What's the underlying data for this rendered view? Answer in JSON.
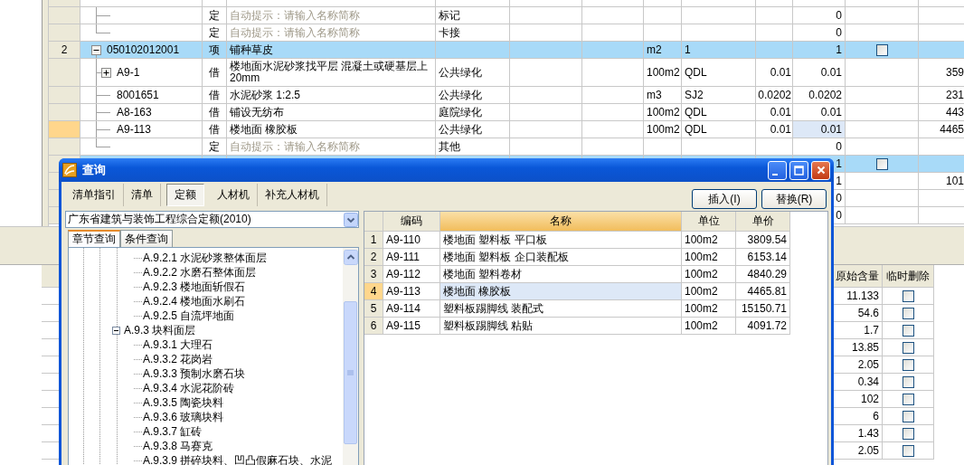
{
  "main_table": {
    "rows": [
      {
        "kind": "sub",
        "column_2": "定",
        "placeholder": "自动提示：请输入名称简称",
        "column_4": "标记",
        "column_10": "0",
        "selected": false,
        "current": false
      },
      {
        "kind": "sub",
        "column_2": "定",
        "placeholder": "自动提示：请输入名称简称",
        "column_4": "卡接",
        "column_10": "0",
        "selected": false,
        "current": false
      },
      {
        "kind": "item",
        "row_number": "2",
        "column_1": "050102012001",
        "expanded": true,
        "column_2": "项",
        "column_3": "铺种草皮",
        "column_7": "m2",
        "column_8": "1",
        "column_10": "1",
        "checked": false,
        "selected": true,
        "current": false,
        "children": [
          {
            "column_1": "A9-1",
            "expanded": false,
            "column_2": "借",
            "column_3": "楼地面水泥砂浆找平层 混凝土或硬基层上 20mm",
            "column_4": "公共绿化",
            "column_7": "100m2",
            "column_8": "QDL",
            "column_9": "0.01",
            "column_10": "0.01",
            "column_12": "359",
            "selected": false,
            "current": false
          },
          {
            "column_1": "8001651",
            "column_2": "借",
            "column_3": "水泥砂浆 1:2.5",
            "column_4": "公共绿化",
            "column_7": "m3",
            "column_8": "SJ2",
            "column_9": "0.0202",
            "column_10": "0.0202",
            "column_12": "231",
            "selected": false,
            "current": false
          },
          {
            "column_1": "A8-163",
            "column_2": "借",
            "column_3": "铺设无纺布",
            "column_4": "庭院绿化",
            "column_7": "100m2",
            "column_8": "QDL",
            "column_9": "0.01",
            "column_10": "0.01",
            "column_12": "443",
            "selected": false,
            "current": false
          },
          {
            "column_1": "A9-113",
            "column_2": "借",
            "column_3": "楼地面 橡胶板",
            "column_4": "公共绿化",
            "column_7": "100m2",
            "column_8": "QDL",
            "column_9": "0.01",
            "column_10": "0.01",
            "column_12": "4465",
            "selected": false,
            "current": true
          },
          {
            "column_2": "定",
            "placeholder": "自动提示：请输入名称简称",
            "column_4": "其他",
            "column_10": "0",
            "selected": false,
            "current": false
          }
        ]
      },
      {
        "kind": "item",
        "column_10": "1",
        "checked": false,
        "selected": true,
        "current": false,
        "children": [
          {
            "column_10": "1",
            "column_12": "101",
            "selected": false,
            "current": false
          },
          {
            "column_10": "0",
            "selected": false,
            "current": false
          },
          {
            "column_10": "0",
            "selected": false,
            "current": false
          }
        ]
      }
    ]
  },
  "lower_table": {
    "columns": [
      {
        "label": "原始含量"
      },
      {
        "label": "临时删除"
      }
    ],
    "rows": [
      {
        "value": "11.133",
        "checked": false
      },
      {
        "value": "54.6",
        "checked": false
      },
      {
        "value": "1.7",
        "checked": false
      },
      {
        "value": "13.85",
        "checked": false
      },
      {
        "value": "2.05",
        "checked": false
      },
      {
        "value": "0.34",
        "checked": false
      },
      {
        "value": "102",
        "checked": false
      },
      {
        "value": "6",
        "checked": false
      },
      {
        "value": "1.43",
        "checked": false
      },
      {
        "value": "2.05",
        "checked": false
      }
    ]
  },
  "dialog": {
    "title": "查询",
    "tabs": [
      {
        "label": "清单指引",
        "selected": false
      },
      {
        "label": "清单",
        "selected": false
      },
      {
        "label": "定额",
        "selected": true
      },
      {
        "label": "人材机",
        "selected": false
      },
      {
        "label": "补充人材机",
        "selected": false
      }
    ],
    "buttons": [
      "插入(I)",
      "替换(R)"
    ],
    "library": {
      "value": "广东省建筑与装饰工程综合定额(2010)"
    },
    "subtabs": [
      {
        "label": "章节查询",
        "selected": true
      },
      {
        "label": "条件查询",
        "selected": false
      }
    ],
    "tree": [
      {
        "children": [
          {
            "label": "A.9.2.1 水泥砂浆整体面层"
          },
          {
            "label": "A.9.2.2 水磨石整体面层"
          },
          {
            "label": "A.9.2.3 楼地面斩假石"
          },
          {
            "label": "A.9.2.4 楼地面水刷石"
          },
          {
            "label": "A.9.2.5 自流坪地面"
          }
        ]
      },
      {
        "label": "A.9.3 块料面层",
        "expanded": true,
        "children": [
          {
            "label": "A.9.3.1 大理石"
          },
          {
            "label": "A.9.3.2 花岗岩"
          },
          {
            "label": "A.9.3.3 预制水磨石块"
          },
          {
            "label": "A.9.3.4 水泥花阶砖"
          },
          {
            "label": "A.9.3.5 陶瓷块料"
          },
          {
            "label": "A.9.3.6 玻璃块料"
          },
          {
            "label": "A.9.3.7 缸砖"
          },
          {
            "label": "A.9.3.8 马赛克"
          },
          {
            "label": "A.9.3.9 拼碎块料、凹凸假麻石块、水泥"
          }
        ]
      }
    ],
    "grid": {
      "columns": [
        {
          "label": "编码",
          "selected": false
        },
        {
          "label": "名称",
          "selected": true
        },
        {
          "label": "单位",
          "selected": false
        },
        {
          "label": "单价",
          "selected": false
        }
      ],
      "rows": [
        {
          "number": "1",
          "code": "A9-110",
          "name": "楼地面 塑料板 平口板",
          "unit": "100m2",
          "price": "3809.54",
          "selected": false
        },
        {
          "number": "2",
          "code": "A9-111",
          "name": "楼地面 塑料板 企口装配板",
          "unit": "100m2",
          "price": "6153.14",
          "selected": false
        },
        {
          "number": "3",
          "code": "A9-112",
          "name": "楼地面 塑料卷材",
          "unit": "100m2",
          "price": "4840.29",
          "selected": false
        },
        {
          "number": "4",
          "code": "A9-113",
          "name": "楼地面 橡胶板",
          "unit": "100m2",
          "price": "4465.81",
          "selected": true
        },
        {
          "number": "5",
          "code": "A9-114",
          "name": "塑料板踢脚线 装配式",
          "unit": "100m2",
          "price": "15150.71",
          "selected": false
        },
        {
          "number": "6",
          "code": "A9-115",
          "name": "塑料板踢脚线 粘贴",
          "unit": "100m2",
          "price": "4091.72",
          "selected": false
        }
      ]
    }
  }
}
